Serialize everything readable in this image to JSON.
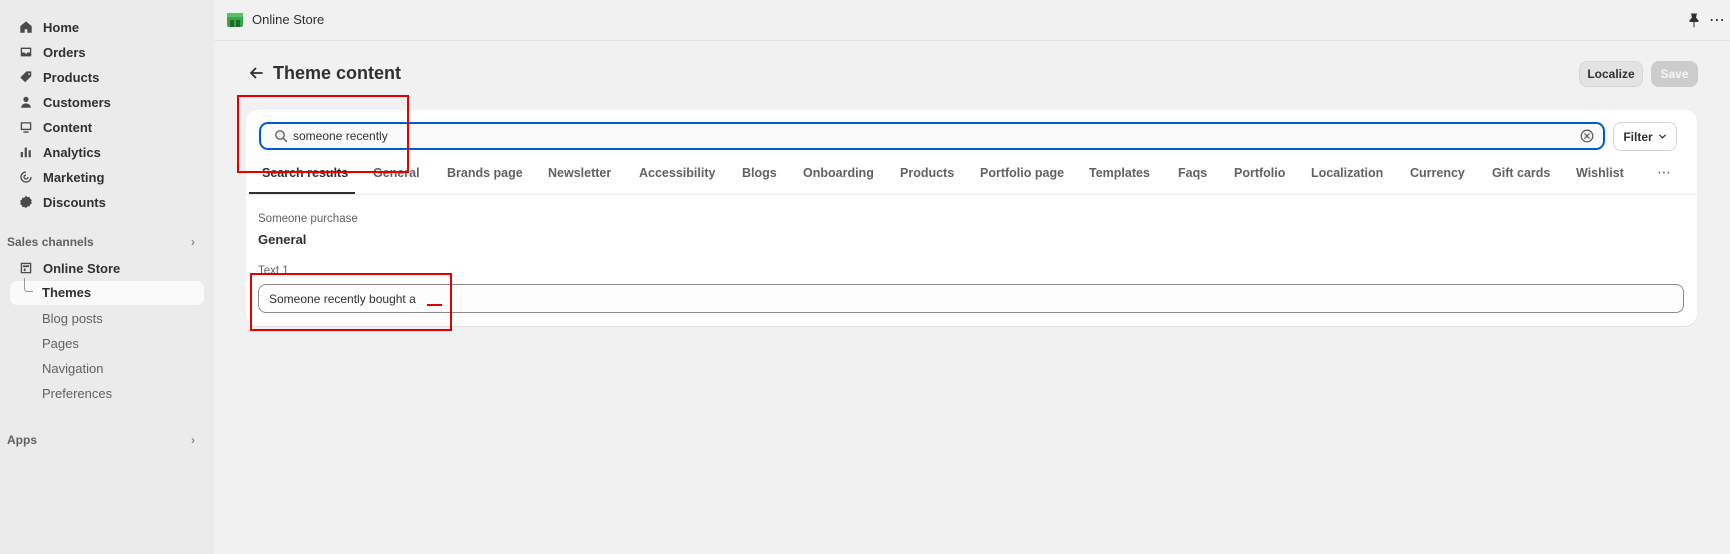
{
  "sidebar": {
    "nav": [
      {
        "label": "Home",
        "icon": "home-icon"
      },
      {
        "label": "Orders",
        "icon": "inbox-icon"
      },
      {
        "label": "Products",
        "icon": "tag-icon"
      },
      {
        "label": "Customers",
        "icon": "person-icon"
      },
      {
        "label": "Content",
        "icon": "image-icon"
      },
      {
        "label": "Analytics",
        "icon": "bar-chart-icon"
      },
      {
        "label": "Marketing",
        "icon": "target-icon"
      },
      {
        "label": "Discounts",
        "icon": "discount-icon"
      }
    ],
    "sales_channels_label": "Sales channels",
    "online_store_label": "Online Store",
    "online_store_sub": [
      "Themes",
      "Blog posts",
      "Pages",
      "Navigation",
      "Preferences"
    ],
    "apps_label": "Apps"
  },
  "topbar": {
    "app_name": "Online Store"
  },
  "header": {
    "title": "Theme content",
    "localize_label": "Localize",
    "save_label": "Save"
  },
  "search": {
    "value": "someone recently",
    "filter_label": "Filter"
  },
  "tabs": [
    "Search results",
    "General",
    "Brands page",
    "Newsletter",
    "Accessibility",
    "Blogs",
    "Onboarding",
    "Products",
    "Portfolio page",
    "Templates",
    "Faqs",
    "Portfolio",
    "Localization",
    "Currency",
    "Gift cards",
    "Wishlist"
  ],
  "result": {
    "subtitle": "Someone purchase",
    "section": "General",
    "field_label": "Text 1",
    "field_value": "Someone recently bought a"
  }
}
